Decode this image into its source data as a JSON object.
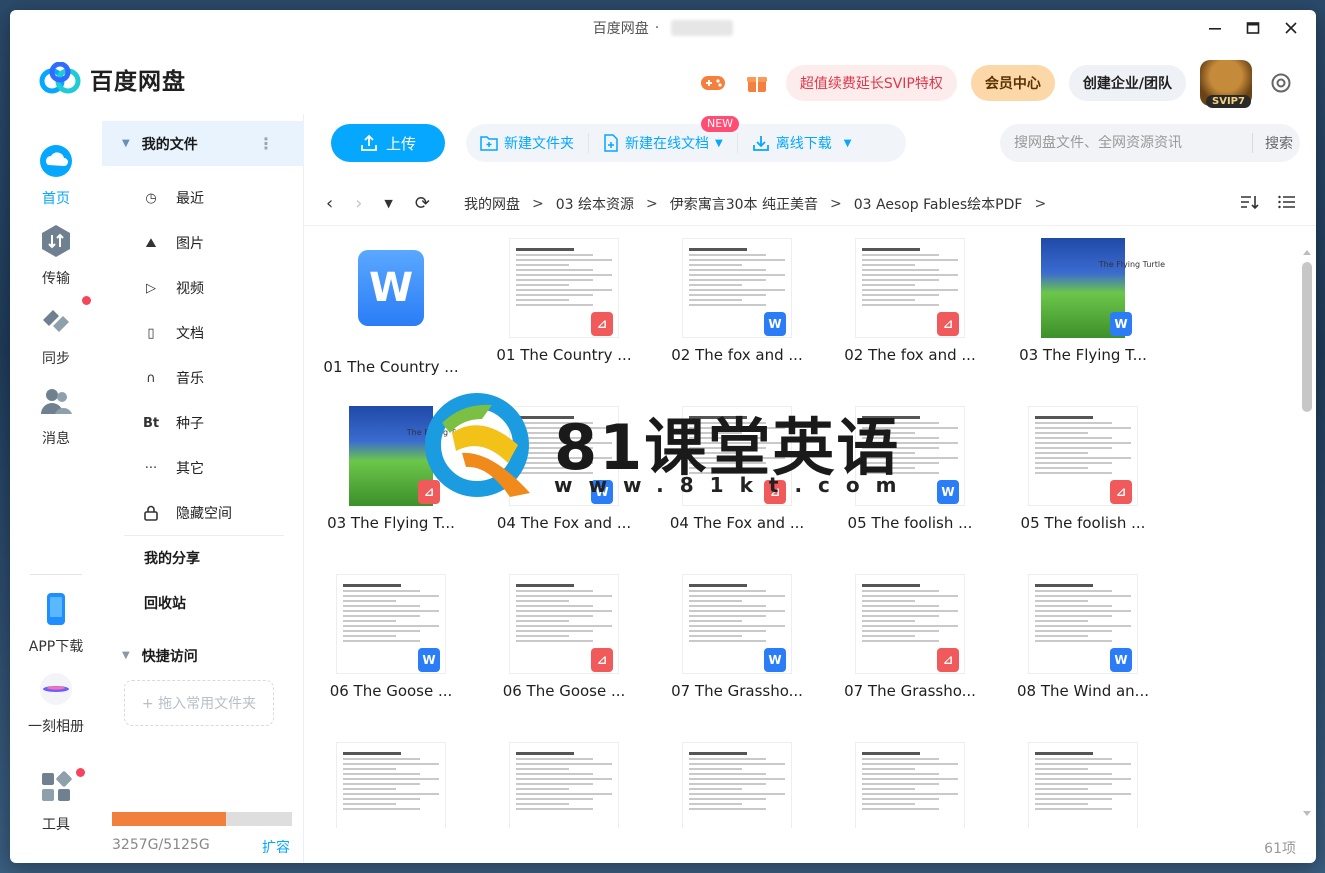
{
  "window": {
    "title": "百度网盘",
    "title_sep": "·"
  },
  "brand": {
    "name": "百度网盘"
  },
  "header": {
    "promo_label": "超值续费延长SVIP特权",
    "vip_label": "会员中心",
    "corp_label": "创建企业/团队",
    "avatar_tag": "SVIP7"
  },
  "rail": [
    {
      "label": "首页"
    },
    {
      "label": "传输"
    },
    {
      "label": "同步"
    },
    {
      "label": "消息"
    },
    {
      "label": "APP下载"
    },
    {
      "label": "一刻相册"
    },
    {
      "label": "工具"
    }
  ],
  "sidebar": {
    "head": "我的文件",
    "items": [
      {
        "label": "最近",
        "icon": "clock-icon",
        "glyph": "◷"
      },
      {
        "label": "图片",
        "icon": "image-icon",
        "glyph": "⛰"
      },
      {
        "label": "视频",
        "icon": "video-icon",
        "glyph": "▷"
      },
      {
        "label": "文档",
        "icon": "document-icon",
        "glyph": "▯"
      },
      {
        "label": "音乐",
        "icon": "headphones-icon",
        "glyph": "∩"
      },
      {
        "label": "种子",
        "icon": "torrent-icon",
        "glyph": "Bt"
      },
      {
        "label": "其它",
        "icon": "more-icon",
        "glyph": "···"
      },
      {
        "label": "隐藏空间",
        "icon": "lock-icon",
        "glyph": "🔒︎"
      }
    ],
    "my_share": "我的分享",
    "recycle": "回收站",
    "quick_access": "快捷访问",
    "drop_hint": "+ 拖入常用文件夹",
    "storage_text": "3257G/5125G",
    "storage_used_fraction": 0.636,
    "expand_label": "扩容"
  },
  "toolbar": {
    "upload_label": "上传",
    "new_folder_label": "新建文件夹",
    "new_doc_label": "新建在线文档",
    "new_badge": "NEW",
    "offline_label": "离线下载",
    "search_placeholder": "搜网盘文件、全网资源资讯",
    "search_button": "搜索"
  },
  "breadcrumb": {
    "items": [
      "我的网盘",
      "03 绘本资源",
      "伊索寓言30本 纯正美音",
      "03 Aesop Fables绘本PDF"
    ],
    "sep": ">"
  },
  "files": [
    {
      "name": "01 The Country ...",
      "kind": "word-icon"
    },
    {
      "name": "01 The Country ...",
      "kind": "pdf"
    },
    {
      "name": "02 The fox and ...",
      "kind": "word"
    },
    {
      "name": "02 The fox and ...",
      "kind": "pdf"
    },
    {
      "name": "03 The Flying T...",
      "kind": "word-cover"
    },
    {
      "name": "03 The Flying T...",
      "kind": "pdf-cover"
    },
    {
      "name": "04 The Fox and ...",
      "kind": "word"
    },
    {
      "name": "04 The Fox and ...",
      "kind": "pdf"
    },
    {
      "name": "05 The foolish ...",
      "kind": "word"
    },
    {
      "name": "05 The foolish ...",
      "kind": "pdf"
    },
    {
      "name": "06 The Goose ...",
      "kind": "word"
    },
    {
      "name": "06 The Goose ...",
      "kind": "pdf"
    },
    {
      "name": "07 The Grassho...",
      "kind": "word"
    },
    {
      "name": "07 The Grassho...",
      "kind": "pdf"
    },
    {
      "name": "08 The Wind an...",
      "kind": "word"
    },
    {
      "name": "",
      "kind": "doc-partial"
    },
    {
      "name": "",
      "kind": "doc-partial"
    },
    {
      "name": "",
      "kind": "doc-partial"
    },
    {
      "name": "",
      "kind": "doc-partial"
    },
    {
      "name": "",
      "kind": "doc-partial"
    }
  ],
  "cover_title": "The Flying Turtle",
  "item_count": "61项",
  "watermark": {
    "title": "81课堂英语",
    "url": "www.81kt.com"
  },
  "colors": {
    "accent": "#06a7ff",
    "promo": "#e0374a",
    "storage": "#f0803c",
    "pdf": "#f05a5a",
    "word": "#2a7df6"
  }
}
